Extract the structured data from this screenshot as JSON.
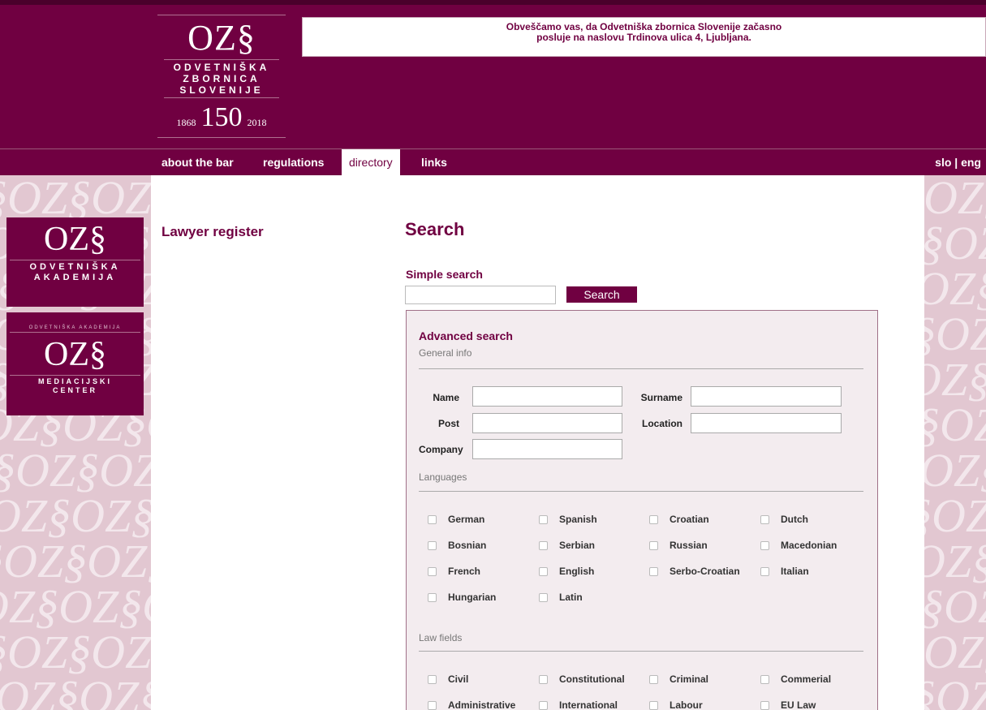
{
  "logo": {
    "ozs": "OZ§",
    "line1": "Odvetniška",
    "line2": "zbornica",
    "line3": "Slovenije",
    "year_start": "1868",
    "year_mid": "150",
    "year_end": "2018"
  },
  "notice": {
    "line1": "Obveščamo vas, da Odvetniška zbornica Slovenije začasno",
    "line2": "posluje na naslovu Trdinova ulica 4, Ljubljana."
  },
  "nav": {
    "items": [
      "about the bar",
      "regulations",
      "directory",
      "links"
    ],
    "active": "directory",
    "lang": "slo | eng"
  },
  "sidebox_a": {
    "ozs": "OZ§",
    "line1": "Odvetniška",
    "line2": "Akademija"
  },
  "sidebox_b": {
    "tiny": "Odvetniška akademija",
    "ozs": "OZ§",
    "line1": "Mediacijski",
    "line2": "Center"
  },
  "pattern_text": "§OZ§OZ§OZ",
  "sidebar": {
    "heading": "Lawyer register"
  },
  "main": {
    "title": "Search",
    "simple_label": "Simple search",
    "search_button": "Search",
    "advanced": {
      "title": "Advanced search",
      "general_info": "General info",
      "fields": {
        "name": "Name",
        "surname": "Surname",
        "post": "Post",
        "location": "Location",
        "company": "Company"
      },
      "languages_label": "Languages",
      "languages": [
        "German",
        "Spanish",
        "Croatian",
        "Dutch",
        "Bosnian",
        "Serbian",
        "Russian",
        "Macedonian",
        "French",
        "English",
        "Serbo-Croatian",
        "Italian",
        "Hungarian",
        "Latin"
      ],
      "law_fields_label": "Law fields",
      "law_fields": [
        "Civil",
        "Constitutional",
        "Criminal",
        "Commerial",
        "Administrative",
        "International",
        "Labour",
        "EU Law"
      ]
    }
  },
  "colors": {
    "brand": "#700041",
    "pattern": "#e2c7d1",
    "panel": "#f3ecef"
  }
}
